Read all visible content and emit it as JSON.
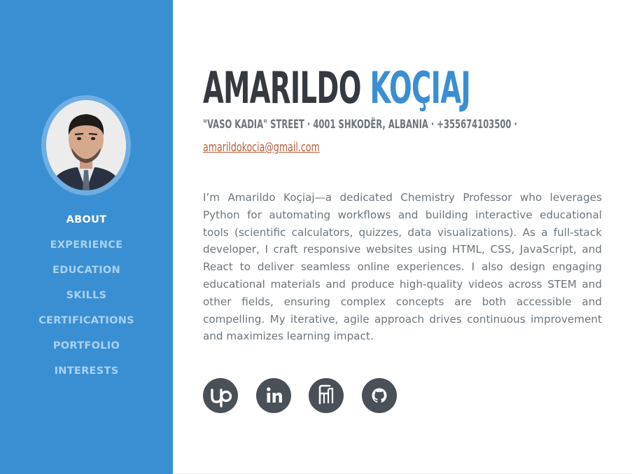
{
  "profile": {
    "first_name": "AMARILDO",
    "last_name": "KOÇIAJ",
    "contact_line": "\"VASO KADIA\" STREET · 4001 SHKODËR, ALBANIA · +355674103500 ·",
    "email": "amarildokocia@gmail.com",
    "bio": "I’m Amarildo Koçiaj—a dedicated Chemistry Professor who leverages Python for automating workflows and building interactive educational tools (scientific calculators, quizzes, data visualizations). As a full-stack developer, I craft responsive websites using HTML, CSS, JavaScript, and React to deliver seamless online experiences. I also design engaging educational materials and produce high-quality videos across STEM and other fields, ensuring complex concepts are both accessible and compelling. My iterative, agile approach drives continuous improvement and maximizes learning impact."
  },
  "nav": {
    "items": [
      {
        "label": "ABOUT",
        "active": true
      },
      {
        "label": "EXPERIENCE",
        "active": false
      },
      {
        "label": "EDUCATION",
        "active": false
      },
      {
        "label": "SKILLS",
        "active": false
      },
      {
        "label": "CERTIFICATIONS",
        "active": false
      },
      {
        "label": "PORTFOLIO",
        "active": false
      },
      {
        "label": "INTERESTS",
        "active": false
      }
    ]
  },
  "social": {
    "icons": [
      "upwork-icon",
      "linkedin-icon",
      "freelancer-icon",
      "github-icon"
    ]
  },
  "colors": {
    "sidebar": "#3a8fd2",
    "accent": "#3a8fd2",
    "heading": "#343a40",
    "body_text": "#6c757d",
    "link": "#bd5d38",
    "nav_active": "#ffffff",
    "nav_inactive": "#a9d1f1",
    "social_bg": "#495057"
  }
}
